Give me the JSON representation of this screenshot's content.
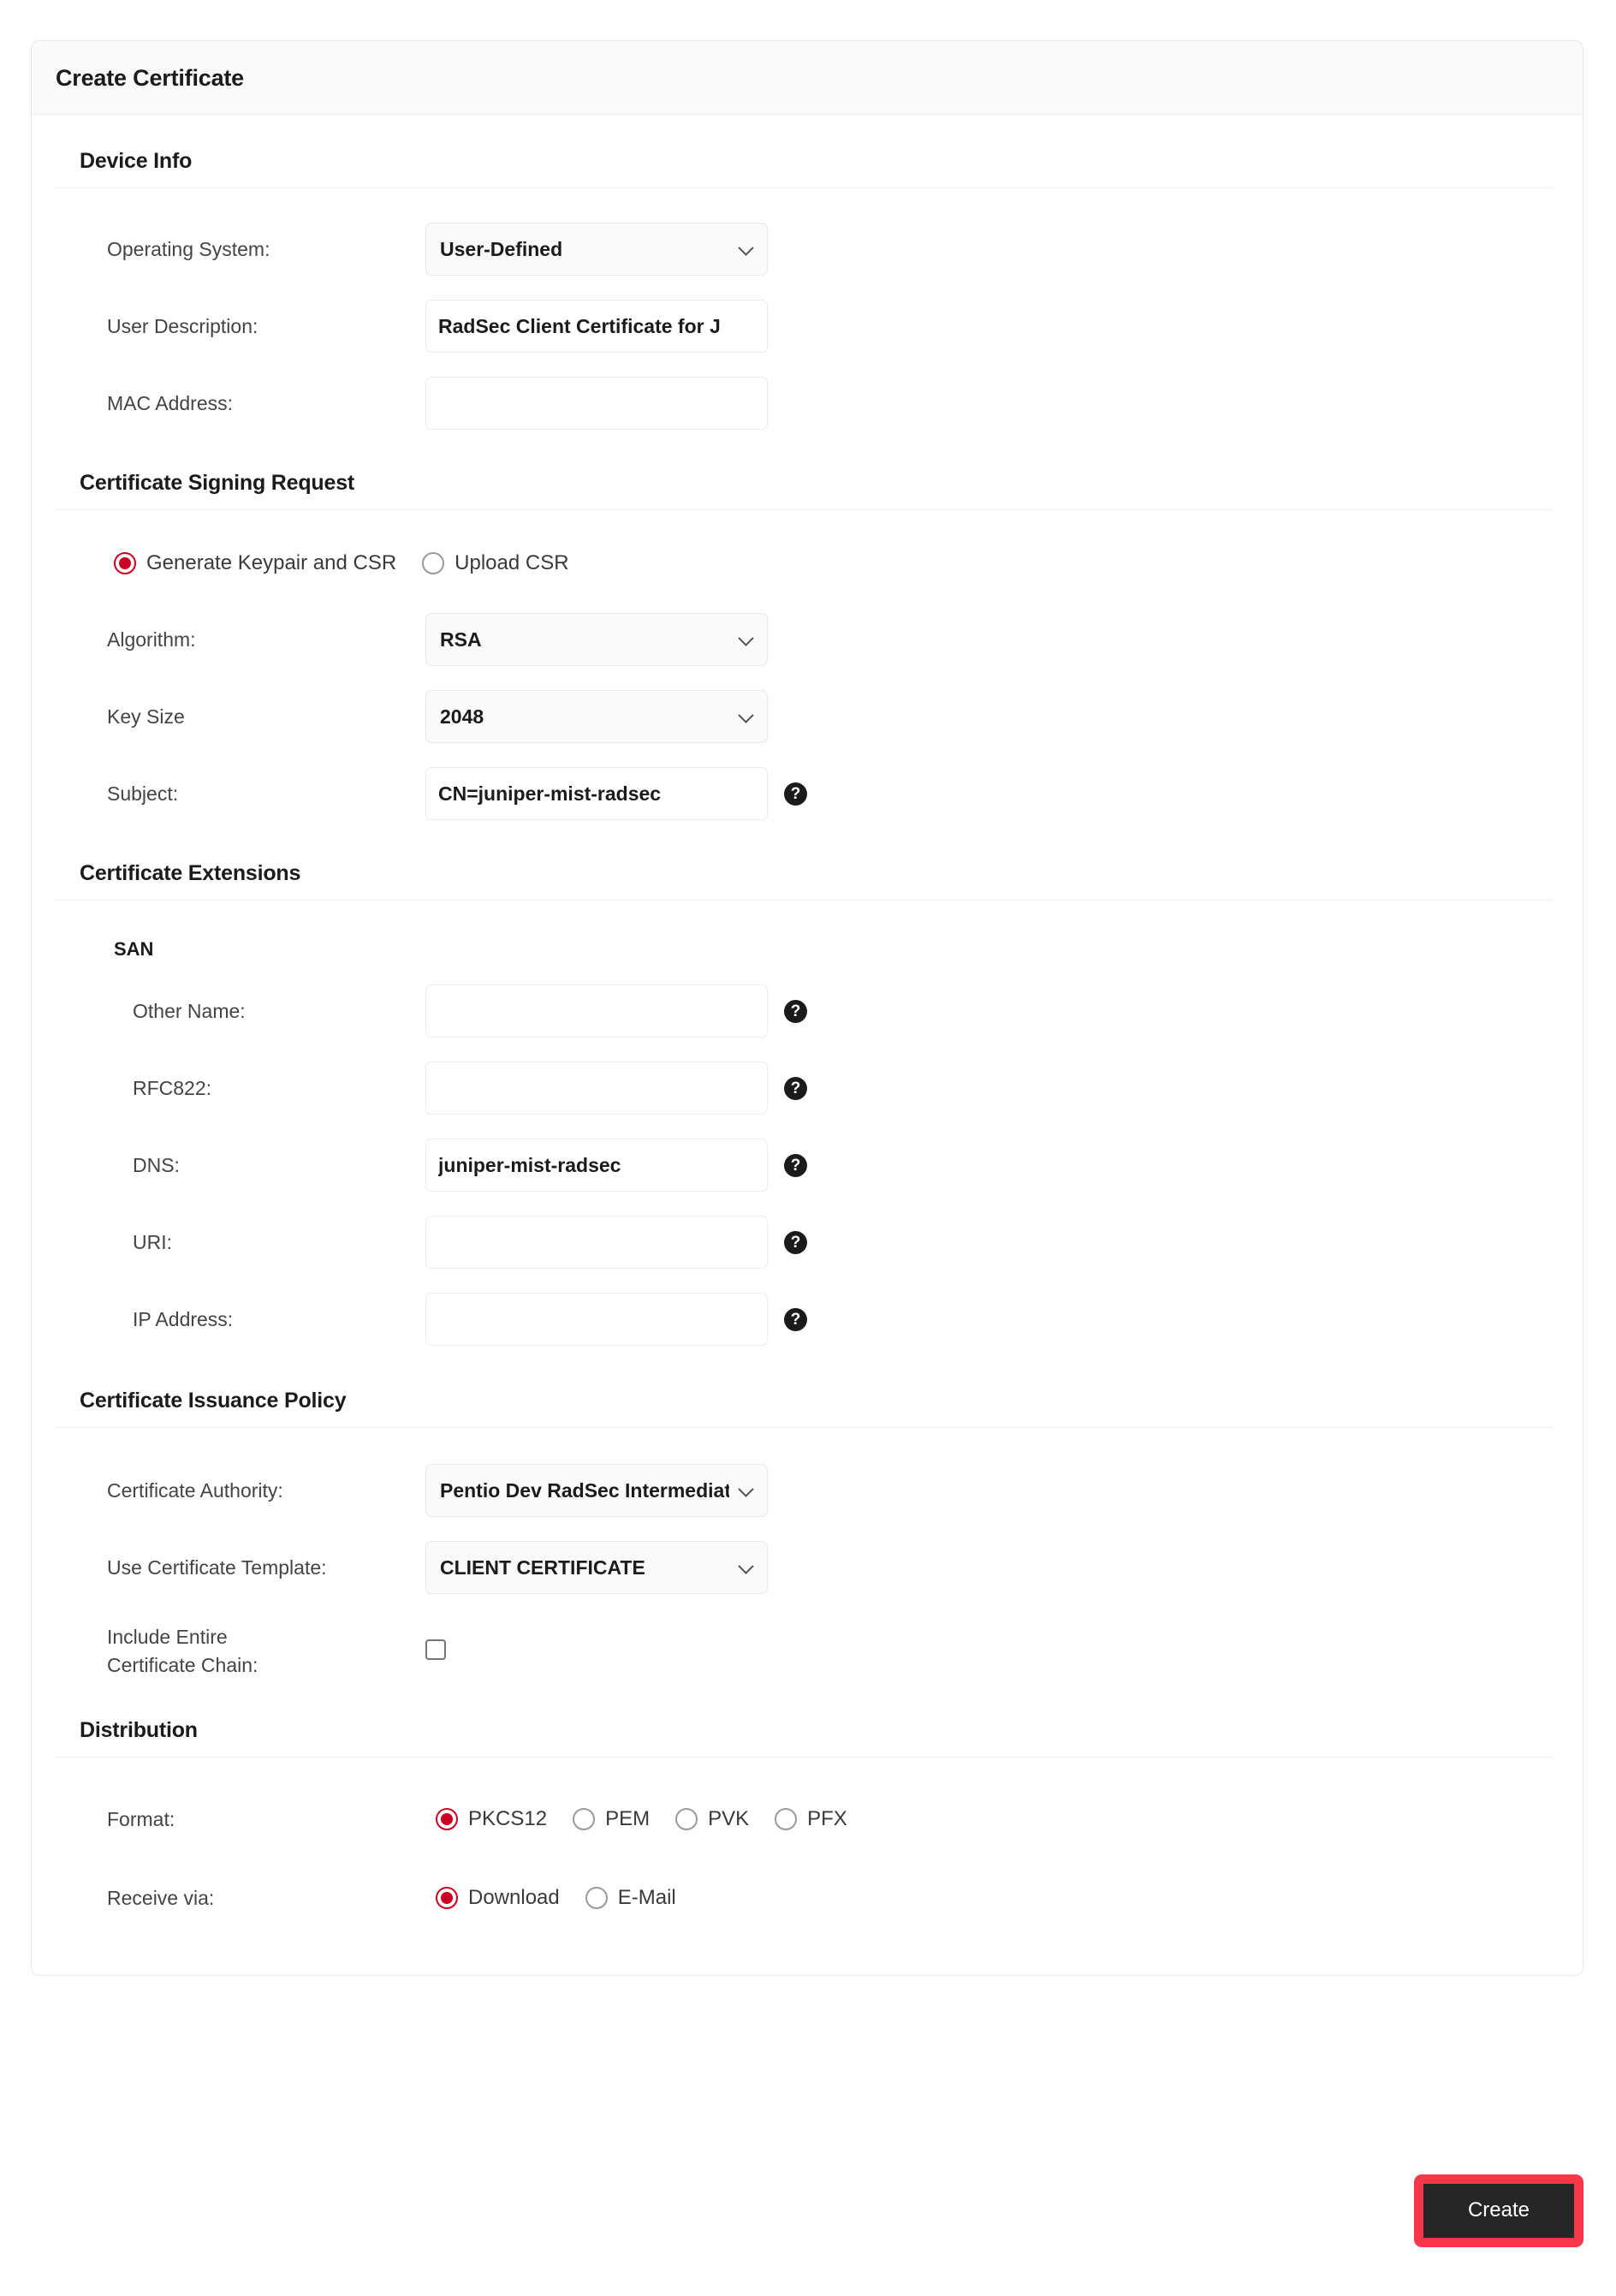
{
  "card": {
    "title": "Create Certificate"
  },
  "sections": {
    "device_info": {
      "heading": "Device Info",
      "fields": {
        "operating_system": {
          "label": "Operating System:",
          "value": "User-Defined",
          "icon": "chevron-down-icon"
        },
        "user_description": {
          "label": "User Description:",
          "value": "RadSec Client Certificate for J",
          "placeholder": ""
        },
        "mac_address": {
          "label": "MAC Address:",
          "value": "",
          "placeholder": ""
        }
      }
    },
    "csr": {
      "heading": "Certificate Signing Request",
      "mode_options": [
        {
          "label": "Generate Keypair and CSR",
          "selected": true
        },
        {
          "label": "Upload CSR",
          "selected": false
        }
      ],
      "fields": {
        "algorithm": {
          "label": "Algorithm:",
          "value": "RSA",
          "icon": "chevron-down-icon"
        },
        "key_size": {
          "label": "Key Size",
          "value": "2048",
          "icon": "chevron-down-icon"
        },
        "subject": {
          "label": "Subject:",
          "value": "CN=juniper-mist-radsec",
          "placeholder": "",
          "help_icon": "help-icon",
          "help_glyph": "?"
        }
      }
    },
    "extensions": {
      "heading": "Certificate Extensions",
      "san_heading": "SAN",
      "fields": [
        {
          "key": "other_name",
          "label": "Other Name:",
          "value": "",
          "help_glyph": "?"
        },
        {
          "key": "rfc822",
          "label": "RFC822:",
          "value": "",
          "help_glyph": "?"
        },
        {
          "key": "dns",
          "label": "DNS:",
          "value": "juniper-mist-radsec",
          "help_glyph": "?"
        },
        {
          "key": "uri",
          "label": "URI:",
          "value": "",
          "help_glyph": "?"
        },
        {
          "key": "ip_address",
          "label": "IP Address:",
          "value": "",
          "help_glyph": "?"
        }
      ]
    },
    "issuance": {
      "heading": "Certificate Issuance Policy",
      "fields": {
        "certificate_authority": {
          "label": "Certificate Authority:",
          "value": "Pentio Dev RadSec Intermediate CA",
          "icon": "chevron-down-icon"
        },
        "certificate_template": {
          "label": "Use Certificate Template:",
          "value": "CLIENT CERTIFICATE",
          "icon": "chevron-down-icon"
        },
        "include_chain": {
          "label": "Include Entire Certificate Chain:",
          "checked": false
        }
      }
    },
    "distribution": {
      "heading": "Distribution",
      "format": {
        "label": "Format:",
        "options": [
          {
            "label": "PKCS12",
            "selected": true
          },
          {
            "label": "PEM",
            "selected": false
          },
          {
            "label": "PVK",
            "selected": false
          },
          {
            "label": "PFX",
            "selected": false
          }
        ]
      },
      "receive_via": {
        "label": "Receive via:",
        "options": [
          {
            "label": "Download",
            "selected": true
          },
          {
            "label": "E-Mail",
            "selected": false
          }
        ]
      }
    }
  },
  "footer": {
    "create_label": "Create"
  },
  "colors": {
    "accent_red": "#cc0022",
    "highlight_red": "#f6374a",
    "button_dark": "#262626",
    "card_header_bg": "#fafafa",
    "border": "#e8e8e8"
  }
}
